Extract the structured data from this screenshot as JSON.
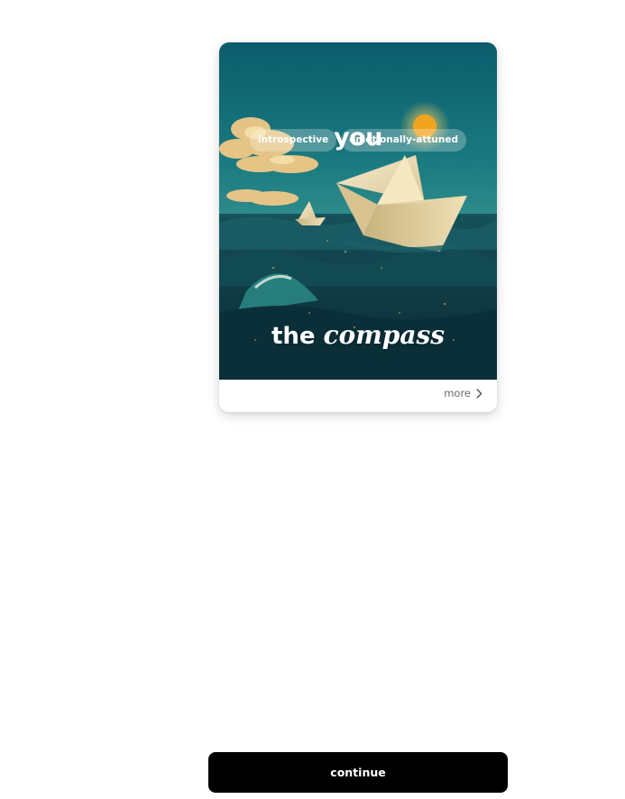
{
  "card": {
    "heading": "you",
    "tags": [
      "introspective",
      "emotionally-attuned"
    ],
    "title_plain": "the",
    "title_italic": "compass",
    "image_icon": "paper-boats-at-sea-illustration",
    "more_label": "more",
    "more_icon": "chevron-right-icon"
  },
  "footer": {
    "continue_label": "continue"
  },
  "colors": {
    "button_bg": "#000000",
    "button_text": "#ffffff",
    "more_text": "#6b6b6b",
    "sea_dark": "#0f3b45",
    "sky_teal": "#0f6f78",
    "sun": "#f2a320"
  }
}
